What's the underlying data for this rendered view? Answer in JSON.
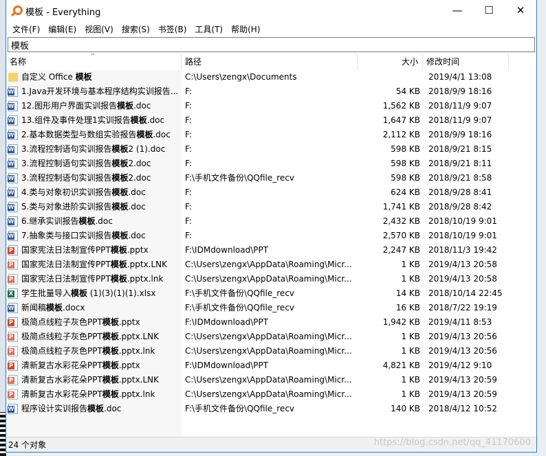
{
  "window": {
    "title": "模板 - Everything",
    "minimize": "—",
    "maximize": "☐",
    "close": "✕"
  },
  "menu": [
    "文件(F)",
    "编辑(E)",
    "视图(V)",
    "搜索(S)",
    "书签(B)",
    "工具(T)",
    "帮助(H)"
  ],
  "search": {
    "value": "模板"
  },
  "columns": {
    "name": "名称",
    "path": "路径",
    "size": "大小",
    "modified": "修改时间",
    "sort_indicator": "^"
  },
  "highlight": "模板",
  "rows": [
    {
      "type": "folder",
      "name": "自定义 Office 模板",
      "path": "C:\\Users\\zengx\\Documents",
      "size": "",
      "modified": "2019/4/1 13:08"
    },
    {
      "type": "doc",
      "name": "1.Java开发环境与基本程序结构实训报告...",
      "path": "F:",
      "size": "54 KB",
      "modified": "2018/9/9 18:16"
    },
    {
      "type": "doc",
      "name": "12.图形用户界面实训报告模板.doc",
      "path": "F:",
      "size": "1,562 KB",
      "modified": "2018/11/9 9:07"
    },
    {
      "type": "doc",
      "name": "13.组件及事件处理1实训报告模板.doc",
      "path": "F:",
      "size": "1,647 KB",
      "modified": "2018/11/9 9:07"
    },
    {
      "type": "doc",
      "name": "2.基本数据类型与数组实验报告模板.doc",
      "path": "F:",
      "size": "2,112 KB",
      "modified": "2018/9/9 18:16"
    },
    {
      "type": "doc",
      "name": "3.流程控制语句实训报告模板2 (1).doc",
      "path": "F:",
      "size": "598 KB",
      "modified": "2018/9/21 8:15"
    },
    {
      "type": "doc",
      "name": "3.流程控制语句实训报告模板2.doc",
      "path": "F:",
      "size": "598 KB",
      "modified": "2018/9/21 8:11"
    },
    {
      "type": "doc",
      "name": "3.流程控制语句实训报告模板2.doc",
      "path": "F:\\手机文件备份\\QQfile_recv",
      "size": "598 KB",
      "modified": "2018/9/21 8:58"
    },
    {
      "type": "doc",
      "name": "4.类与对象初识实训报告模板.doc",
      "path": "F:",
      "size": "624 KB",
      "modified": "2018/9/28 8:41"
    },
    {
      "type": "doc",
      "name": "5.类与对象进阶实训报告模板.doc",
      "path": "F:",
      "size": "1,741 KB",
      "modified": "2018/9/28 8:42"
    },
    {
      "type": "doc",
      "name": "6.继承实训报告模板.doc",
      "path": "F:",
      "size": "2,432 KB",
      "modified": "2018/10/19 9:01"
    },
    {
      "type": "doc",
      "name": "7.抽象类与接口实训报告模板.doc",
      "path": "F:",
      "size": "2,570 KB",
      "modified": "2018/10/19 9:01"
    },
    {
      "type": "ppt",
      "name": "国家宪法日法制宣传PPT模板.pptx",
      "path": "F:\\IDMdownload\\PPT",
      "size": "2,247 KB",
      "modified": "2018/11/3 19:42"
    },
    {
      "type": "ppt-lnk",
      "name": "国家宪法日法制宣传PPT模板.pptx.LNK",
      "path": "C:\\Users\\zengx\\AppData\\Roaming\\Micr...",
      "size": "1 KB",
      "modified": "2019/4/13 20:58"
    },
    {
      "type": "ppt-lnk",
      "name": "国家宪法日法制宣传PPT模板.pptx.lnk",
      "path": "C:\\Users\\zengx\\AppData\\Roaming\\Micr...",
      "size": "1 KB",
      "modified": "2019/4/13 20:58"
    },
    {
      "type": "xls",
      "name": "学生批量导入模板 (1)(3)(1)(1).xlsx",
      "path": "F:\\手机文件备份\\QQfile_recv",
      "size": "14 KB",
      "modified": "2018/10/14 22:45"
    },
    {
      "type": "doc",
      "name": "新闻稿模板.docx",
      "path": "F:\\手机文件备份\\QQfile_recv",
      "size": "16 KB",
      "modified": "2018/7/22 19:19"
    },
    {
      "type": "ppt",
      "name": "极简点线粒子灰色PPT模板.pptx",
      "path": "F:\\IDMdownload\\PPT",
      "size": "1,942 KB",
      "modified": "2019/4/11 8:53"
    },
    {
      "type": "ppt-lnk",
      "name": "极简点线粒子灰色PPT模板.pptx.LNK",
      "path": "C:\\Users\\zengx\\AppData\\Roaming\\Micr...",
      "size": "1 KB",
      "modified": "2019/4/13 20:56"
    },
    {
      "type": "ppt-lnk",
      "name": "极简点线粒子灰色PPT模板.pptx.lnk",
      "path": "C:\\Users\\zengx\\AppData\\Roaming\\Micr...",
      "size": "1 KB",
      "modified": "2019/4/13 20:56"
    },
    {
      "type": "ppt",
      "name": "清新复古水彩花朵PPT模板.pptx",
      "path": "F:\\IDMdownload\\PPT",
      "size": "4,821 KB",
      "modified": "2019/4/12 9:10"
    },
    {
      "type": "ppt-lnk",
      "name": "清新复古水彩花朵PPT模板.pptx.LNK",
      "path": "C:\\Users\\zengx\\AppData\\Roaming\\Micr...",
      "size": "1 KB",
      "modified": "2019/4/13 20:59"
    },
    {
      "type": "ppt-lnk",
      "name": "清新复古水彩花朵PPT模板.pptx.lnk",
      "path": "C:\\Users\\zengx\\AppData\\Roaming\\Micr...",
      "size": "1 KB",
      "modified": "2019/4/13 20:59"
    },
    {
      "type": "doc",
      "name": "程序设计实训报告模板.doc",
      "path": "F:\\手机文件备份\\QQfile_recv",
      "size": "140 KB",
      "modified": "2018/4/12 10:52"
    }
  ],
  "status": "24 个对象",
  "watermark": "https://blog.csdn.net/qq_41170600"
}
